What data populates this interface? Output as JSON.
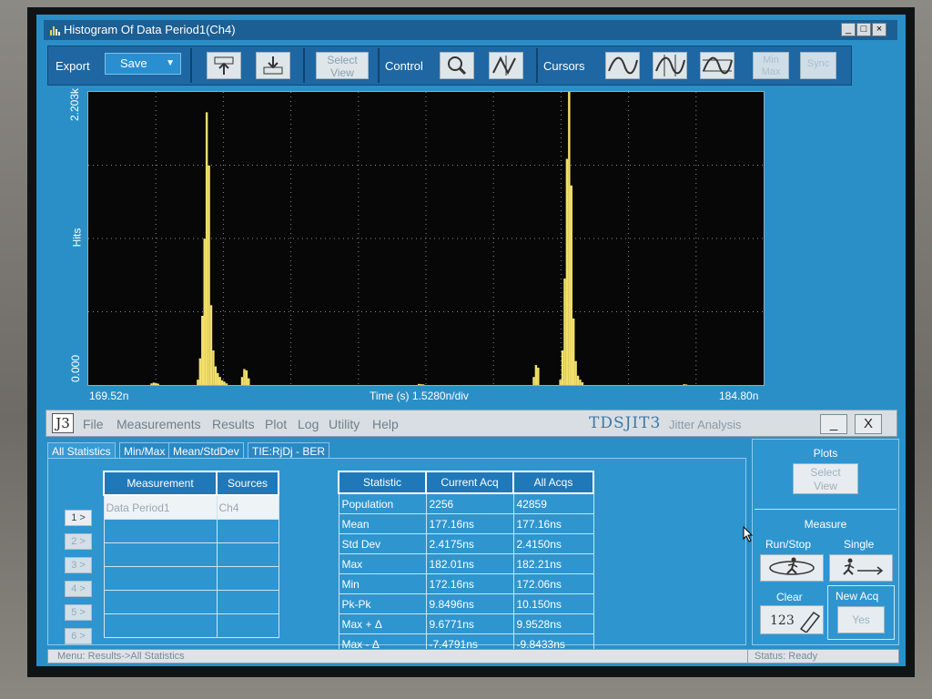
{
  "window": {
    "title": "Histogram Of Data Period1(Ch4)"
  },
  "toolbar": {
    "export_label": "Export",
    "save_label": "Save",
    "select_view_label": [
      "Select",
      "View"
    ],
    "control_label": "Control",
    "cursors_label": "Cursors",
    "minmax_label": [
      "Min",
      "Max"
    ],
    "sync_label": "Sync"
  },
  "plot": {
    "y_top": "2.203k",
    "y_label": "Hits",
    "y_bottom": "0.000",
    "x_left": "169.52n",
    "x_center": "Time (s)   1.5280n/div",
    "x_right": "184.80n",
    "trace_color": "#f2e06a",
    "chart_data": {
      "type": "bar",
      "xlim": [
        169.52,
        184.8
      ],
      "ylim": [
        0,
        2203
      ],
      "x": [
        170.95,
        171.0,
        171.05,
        171.1,
        172.0,
        172.05,
        172.1,
        172.15,
        172.2,
        172.25,
        172.3,
        172.35,
        172.4,
        172.45,
        172.5,
        172.55,
        172.6,
        172.65,
        173.0,
        173.05,
        173.1,
        173.15,
        177.0,
        177.05,
        177.1,
        179.6,
        179.65,
        179.7,
        180.2,
        180.25,
        180.3,
        180.35,
        180.4,
        180.45,
        180.5,
        180.55,
        180.6,
        180.65,
        180.7,
        183.0,
        183.05
      ],
      "values": [
        12,
        18,
        15,
        10,
        40,
        200,
        520,
        1100,
        2050,
        1650,
        600,
        260,
        140,
        90,
        60,
        35,
        25,
        12,
        60,
        120,
        110,
        50,
        8,
        6,
        5,
        60,
        150,
        130,
        40,
        260,
        800,
        1700,
        2300,
        1500,
        500,
        180,
        70,
        40,
        20,
        6,
        4
      ]
    }
  },
  "app": {
    "logo": "J3",
    "menu": [
      "File",
      "Measurements",
      "Results",
      "Plot",
      "Log",
      "Utility",
      "Help"
    ],
    "brand": "TDSJIT3",
    "brand_sub": "Jitter Analysis",
    "minimize_label": "_",
    "close_label": "X"
  },
  "tabs": [
    "All Statistics",
    "Min/Max",
    "Mean/StdDev",
    "TIE:RjDj - BER"
  ],
  "row_buttons": [
    "1 >",
    "2 >",
    "3 >",
    "4 >",
    "5 >",
    "6 >"
  ],
  "measurements": {
    "headers": [
      "Measurement",
      "Sources"
    ],
    "rows": [
      [
        "Data Period1",
        "Ch4"
      ],
      [
        "",
        ""
      ],
      [
        "",
        ""
      ],
      [
        "",
        ""
      ],
      [
        "",
        ""
      ],
      [
        "",
        ""
      ]
    ]
  },
  "statistics": {
    "headers": [
      "Statistic",
      "Current Acq",
      "All Acqs"
    ],
    "rows": [
      [
        "Population",
        "2256",
        "42859"
      ],
      [
        "Mean",
        "177.16ns",
        "177.16ns"
      ],
      [
        "Std Dev",
        "2.4175ns",
        "2.4150ns"
      ],
      [
        "Max",
        "182.01ns",
        "182.21ns"
      ],
      [
        "Min",
        "172.16ns",
        "172.06ns"
      ],
      [
        "Pk-Pk",
        "9.8496ns",
        "10.150ns"
      ],
      [
        "Max + Δ",
        "9.6771ns",
        "9.9528ns"
      ],
      [
        "Max - Δ",
        "-7.4791ns",
        "-9.8433ns"
      ]
    ]
  },
  "side": {
    "plots_label": "Plots",
    "select_view": [
      "Select",
      "View"
    ],
    "measure_label": "Measure",
    "runstop_label": "Run/Stop",
    "single_label": "Single",
    "clear_label": "Clear",
    "clear_icon_text": "123",
    "newacq_label": "New Acq",
    "yes_label": "Yes"
  },
  "status": {
    "menu_path": "Menu: Results->All Statistics",
    "state": "Status: Ready"
  }
}
